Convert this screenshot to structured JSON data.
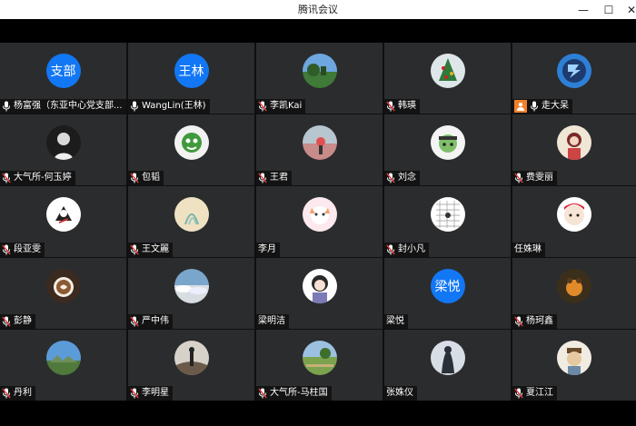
{
  "window": {
    "title": "腾讯会议",
    "min_label": "—",
    "max_label": "☐",
    "close_label": "✕"
  },
  "participants": [
    {
      "name": "杨富强（东亚中心党支部...",
      "avatar_text": "支部",
      "mic": "on"
    },
    {
      "name": "WangLin(王林)",
      "avatar_text": "王林",
      "mic": "on"
    },
    {
      "name": "李凯Kai",
      "avatar_text": "",
      "mic": "muted"
    },
    {
      "name": "韩瑛",
      "avatar_text": "",
      "mic": "muted"
    },
    {
      "name": "走大呆",
      "avatar_text": "",
      "mic": "on",
      "host": true
    },
    {
      "name": "大气所-何玉婷",
      "avatar_text": "",
      "mic": "muted"
    },
    {
      "name": "包韬",
      "avatar_text": "",
      "mic": "muted"
    },
    {
      "name": "王君",
      "avatar_text": "",
      "mic": "muted"
    },
    {
      "name": "刘念",
      "avatar_text": "",
      "mic": "muted"
    },
    {
      "name": "费雯丽",
      "avatar_text": "",
      "mic": "muted"
    },
    {
      "name": "段亚雯",
      "avatar_text": "",
      "mic": "muted"
    },
    {
      "name": "王文麗",
      "avatar_text": "",
      "mic": "muted"
    },
    {
      "name": "李月",
      "avatar_text": "",
      "mic": "none"
    },
    {
      "name": "封小凡",
      "avatar_text": "",
      "mic": "muted"
    },
    {
      "name": "任姝琳",
      "avatar_text": "",
      "mic": "none"
    },
    {
      "name": "彭静",
      "avatar_text": "",
      "mic": "muted"
    },
    {
      "name": "严中伟",
      "avatar_text": "",
      "mic": "muted"
    },
    {
      "name": "梁明洁",
      "avatar_text": "",
      "mic": "none"
    },
    {
      "name": "梁悦",
      "avatar_text": "梁悦",
      "mic": "none"
    },
    {
      "name": "杨珂鑫",
      "avatar_text": "",
      "mic": "muted"
    },
    {
      "name": "丹利",
      "avatar_text": "",
      "mic": "muted"
    },
    {
      "name": "李明星",
      "avatar_text": "",
      "mic": "muted"
    },
    {
      "name": "大气所-马柱国",
      "avatar_text": "",
      "mic": "muted"
    },
    {
      "name": "张姝仪",
      "avatar_text": "",
      "mic": "none"
    },
    {
      "name": "夏江江",
      "avatar_text": "",
      "mic": "muted"
    }
  ]
}
